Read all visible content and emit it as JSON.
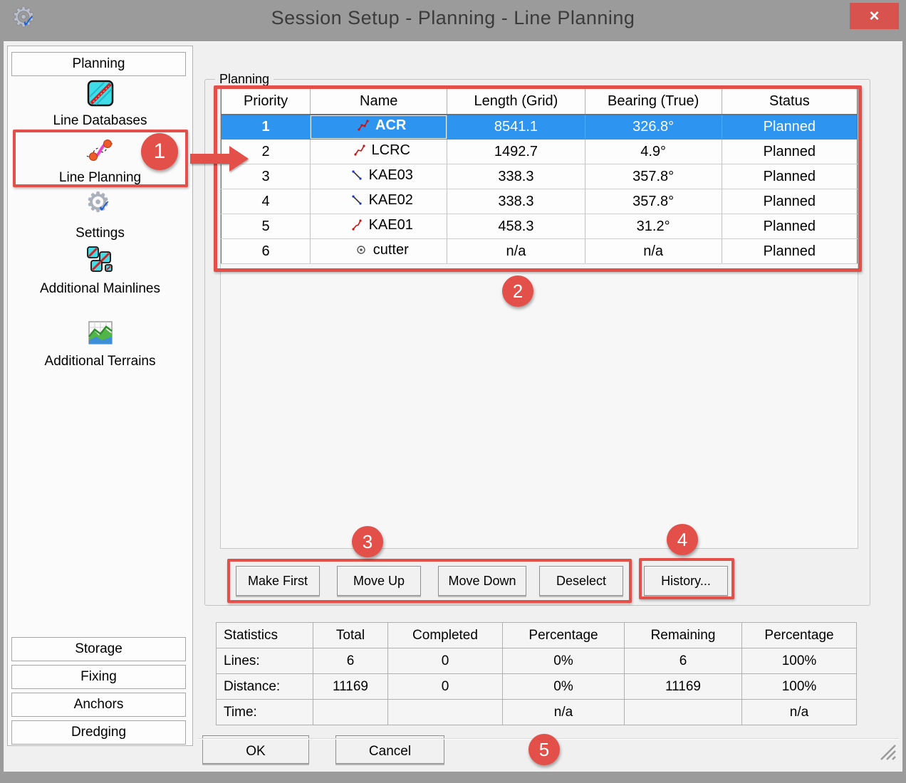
{
  "window": {
    "title": "Session Setup - Planning -  Line Planning",
    "close": "×"
  },
  "sidebar": {
    "header": "Planning",
    "items": [
      {
        "label": "Line Databases",
        "icon": "line-databases-icon"
      },
      {
        "label": "Line Planning",
        "icon": "line-planning-icon"
      },
      {
        "label": "Settings",
        "icon": "settings-icon"
      },
      {
        "label": "Additional Mainlines",
        "icon": "additional-mainlines-icon"
      },
      {
        "label": "Additional Terrains",
        "icon": "additional-terrains-icon"
      }
    ],
    "bottom_items": [
      {
        "label": "Storage"
      },
      {
        "label": "Fixing"
      },
      {
        "label": "Anchors"
      },
      {
        "label": "Dredging"
      }
    ]
  },
  "planning": {
    "groupbox_label": "Planning",
    "table": {
      "columns": [
        "Priority",
        "Name",
        "Length (Grid)",
        "Bearing (True)",
        "Status"
      ],
      "rows": [
        {
          "priority": "1",
          "name": "ACR",
          "length": "8541.1",
          "bearing": "326.8°",
          "status": "Planned",
          "icon": "red-polyline-icon",
          "selected": true
        },
        {
          "priority": "2",
          "name": "LCRC",
          "length": "1492.7",
          "bearing": "4.9°",
          "status": "Planned",
          "icon": "red-polyline-icon",
          "selected": false
        },
        {
          "priority": "3",
          "name": "KAE03",
          "length": "338.3",
          "bearing": "357.8°",
          "status": "Planned",
          "icon": "black-line-icon",
          "selected": false
        },
        {
          "priority": "4",
          "name": "KAE02",
          "length": "338.3",
          "bearing": "357.8°",
          "status": "Planned",
          "icon": "black-line-icon",
          "selected": false
        },
        {
          "priority": "5",
          "name": "KAE01",
          "length": "458.3",
          "bearing": "31.2°",
          "status": "Planned",
          "icon": "red-polyline-icon",
          "selected": false
        },
        {
          "priority": "6",
          "name": "cutter",
          "length": "n/a",
          "bearing": "n/a",
          "status": "Planned",
          "icon": "cutter-circle-icon",
          "selected": false
        }
      ]
    },
    "actions": {
      "make_first": "Make First",
      "move_up": "Move Up",
      "move_down": "Move Down",
      "deselect": "Deselect",
      "history": "History..."
    }
  },
  "statistics": {
    "columns": [
      "Statistics",
      "Total",
      "Completed",
      "Percentage",
      "Remaining",
      "Percentage"
    ],
    "rows": [
      {
        "label": "Lines:",
        "total": "6",
        "completed": "0",
        "percentage": "0%",
        "remaining": "6",
        "remaining_percentage": "100%"
      },
      {
        "label": "Distance:",
        "total": "11169",
        "completed": "0",
        "percentage": "0%",
        "remaining": "11169",
        "remaining_percentage": "100%"
      },
      {
        "label": "Time:",
        "total": "",
        "completed": "",
        "percentage": "n/a",
        "remaining": "",
        "remaining_percentage": "n/a"
      }
    ]
  },
  "footer": {
    "ok": "OK",
    "cancel": "Cancel"
  },
  "annotations": {
    "step1": "1",
    "step2": "2",
    "step3": "3",
    "step4": "4",
    "step5": "5"
  },
  "colors": {
    "annotation_red": "#e25049",
    "selection_blue": "#2d95f0",
    "title_bar_gray": "#9b9b9b",
    "close_red": "#d8534e",
    "client_bg": "#f0f0f0"
  }
}
